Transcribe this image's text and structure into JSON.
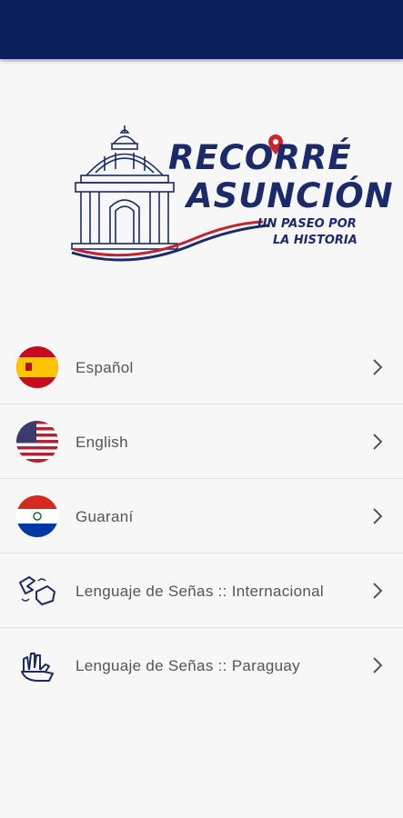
{
  "header": {
    "bar_color": "#0a1f5c"
  },
  "logo": {
    "title_line1": "RECORRÉ",
    "title_line2": "ASUNCIÓN",
    "tagline_line1": "UN PASEO POR",
    "tagline_line2": "LA HISTORIA",
    "icon": "cabildo-building-logo"
  },
  "languages": [
    {
      "label": "Español",
      "icon": "spain-flag-icon"
    },
    {
      "label": "English",
      "icon": "usa-flag-icon"
    },
    {
      "label": "Guaraní",
      "icon": "paraguay-flag-icon"
    },
    {
      "label": "Lenguaje de Señas :: Internacional",
      "icon": "sign-language-icon"
    },
    {
      "label": "Lenguaje de Señas :: Paraguay",
      "icon": "sign-language-hands-icon"
    }
  ]
}
